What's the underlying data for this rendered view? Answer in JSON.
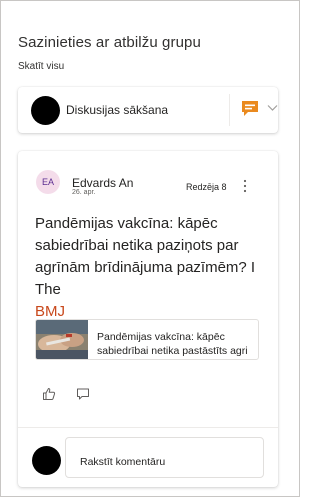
{
  "header": {
    "title": "Sazinieties ar atbilžu grupu",
    "see_all": "Skatīt visu"
  },
  "start_discussion": {
    "label": "Diskusijas sākšana",
    "accent_color": "#ea8a1f"
  },
  "post": {
    "author_initials": "EA",
    "author_name": "Edvards An",
    "date": "26. apr.",
    "seen_label": "Redzēja 8",
    "text": "Pandēmijas vakcīna: kāpēc sabiedrībai netika paziņots par agrīnām brīdinājuma pazīmēm? I The",
    "link_text": "BMJ",
    "link_color": "#c8481b",
    "link_preview": {
      "title": "Pandēmijas vakcīna: kāpēc sabiedrībai netika pastāstīts agri"
    },
    "actions": {
      "like_icon": "like-icon",
      "comment_icon": "comment-icon"
    }
  },
  "comment": {
    "placeholder": "Rakstīt komentāru"
  }
}
